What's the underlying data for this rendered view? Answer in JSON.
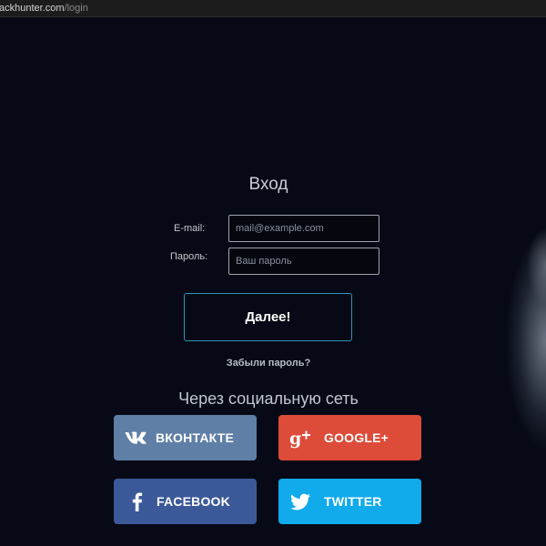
{
  "browser": {
    "url_host": "ackhunter.com",
    "url_path": "/login"
  },
  "login": {
    "title": "Вход",
    "email_label": "E-mail:",
    "email_placeholder": "mail@example.com",
    "password_label": "Пароль:",
    "password_placeholder": "Ваш пароль",
    "submit_label": "Далее!",
    "forgot_label": "Забыли пароль?"
  },
  "social": {
    "title": "Через социальную сеть",
    "buttons": [
      {
        "label": "ВКОНТАКТЕ",
        "icon": "vk-icon",
        "color": "#5f7fa6"
      },
      {
        "label": "GOOGLE+",
        "icon": "google-plus-icon",
        "color": "#dd4b39"
      },
      {
        "label": "FACEBOOK",
        "icon": "facebook-icon",
        "color": "#3b5998"
      },
      {
        "label": "TWITTER",
        "icon": "twitter-icon",
        "color": "#11aaea"
      }
    ]
  },
  "colors": {
    "background": "#070a16",
    "submit_border": "#2f93b7"
  }
}
